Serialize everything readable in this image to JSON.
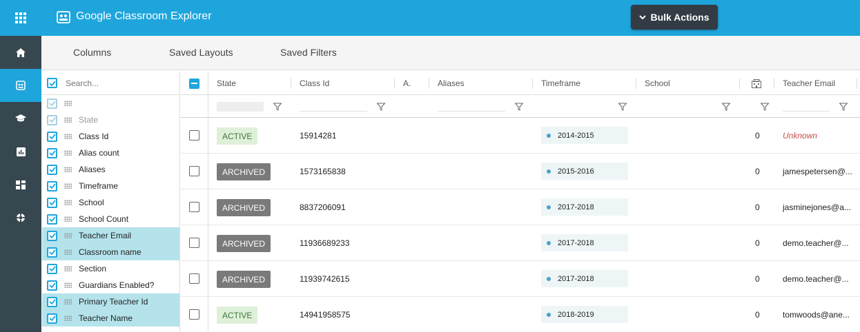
{
  "app": {
    "title": "Google Classroom Explorer"
  },
  "toolbar": {
    "bulk_actions_label": "Bulk Actions"
  },
  "rail": {
    "items": [
      "apps-icon",
      "home-icon",
      "classroom-icon",
      "school-icon",
      "chart-icon",
      "dashboard-icon",
      "settings-icon"
    ]
  },
  "tabs": [
    {
      "label": "Columns"
    },
    {
      "label": "Saved Layouts"
    },
    {
      "label": "Saved Filters"
    }
  ],
  "panel": {
    "search_placeholder": "Search...",
    "items": [
      {
        "label": ""
      },
      {
        "label": "State"
      },
      {
        "label": "Class Id"
      },
      {
        "label": "Alias count"
      },
      {
        "label": "Aliases"
      },
      {
        "label": "Timeframe"
      },
      {
        "label": "School"
      },
      {
        "label": "School Count"
      },
      {
        "label": "Teacher Email"
      },
      {
        "label": "Classroom name"
      },
      {
        "label": "Section"
      },
      {
        "label": "Guardians Enabled?"
      },
      {
        "label": "Primary Teacher Id"
      },
      {
        "label": "Teacher Name"
      }
    ]
  },
  "grid": {
    "headers": {
      "state": "State",
      "class_id": "Class Id",
      "alias_count": "A.",
      "aliases": "Aliases",
      "timeframe": "Timeframe",
      "school": "School",
      "teacher_email": "Teacher Email"
    },
    "rows": [
      {
        "state": "ACTIVE",
        "class_id": "15914281",
        "timeframe": "2014-2015",
        "school_count": "0",
        "teacher_email": "Unknown"
      },
      {
        "state": "ARCHIVED",
        "class_id": "1573165838",
        "timeframe": "2015-2016",
        "school_count": "0",
        "teacher_email": "jamespetersen@..."
      },
      {
        "state": "ARCHIVED",
        "class_id": "8837206091",
        "timeframe": "2017-2018",
        "school_count": "0",
        "teacher_email": "jasminejones@a..."
      },
      {
        "state": "ARCHIVED",
        "class_id": "11936689233",
        "timeframe": "2017-2018",
        "school_count": "0",
        "teacher_email": "demo.teacher@..."
      },
      {
        "state": "ARCHIVED",
        "class_id": "11939742615",
        "timeframe": "2017-2018",
        "school_count": "0",
        "teacher_email": "demo.teacher@..."
      },
      {
        "state": "ACTIVE",
        "class_id": "14941958575",
        "timeframe": "2018-2019",
        "school_count": "0",
        "teacher_email": "tomwoods@ane..."
      }
    ]
  },
  "colors": {
    "accent": "#1ea5dc",
    "rail": "#37474f",
    "active_bg": "#dff0d8",
    "archived_bg": "#7a7a7a"
  }
}
